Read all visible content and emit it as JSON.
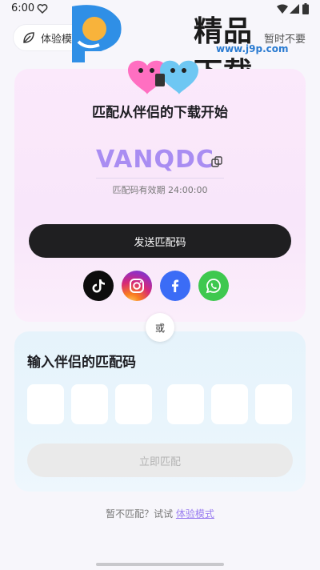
{
  "status_bar": {
    "time": "6:00"
  },
  "top_bar": {
    "trial_mode_label": "体验模式",
    "skip_label": "暂时不要"
  },
  "watermark": {
    "brand": "精品下载",
    "url": "www.j9p.com"
  },
  "pairing": {
    "title": "匹配从伴侣的下载开始",
    "code": "VANQDC",
    "validity": "匹配码有效期 24:00:00",
    "send_button": "发送匹配码",
    "share_icons": [
      "tiktok-icon",
      "instagram-icon",
      "facebook-icon",
      "whatsapp-icon"
    ]
  },
  "divider": {
    "or_label": "或"
  },
  "input_section": {
    "title": "输入伴侣的匹配码",
    "digits": [
      "",
      "",
      "",
      "",
      "",
      ""
    ],
    "confirm_button": "立即匹配"
  },
  "footer": {
    "prefix": "暂不匹配？试试 ",
    "link": "体验模式"
  },
  "colors": {
    "code_accent": "#a98df2",
    "send_button_bg": "#1f1f21",
    "top_card_bg": "#f8e6fa",
    "bottom_card_bg": "#e6f3fb",
    "link": "#9a7ef0"
  }
}
